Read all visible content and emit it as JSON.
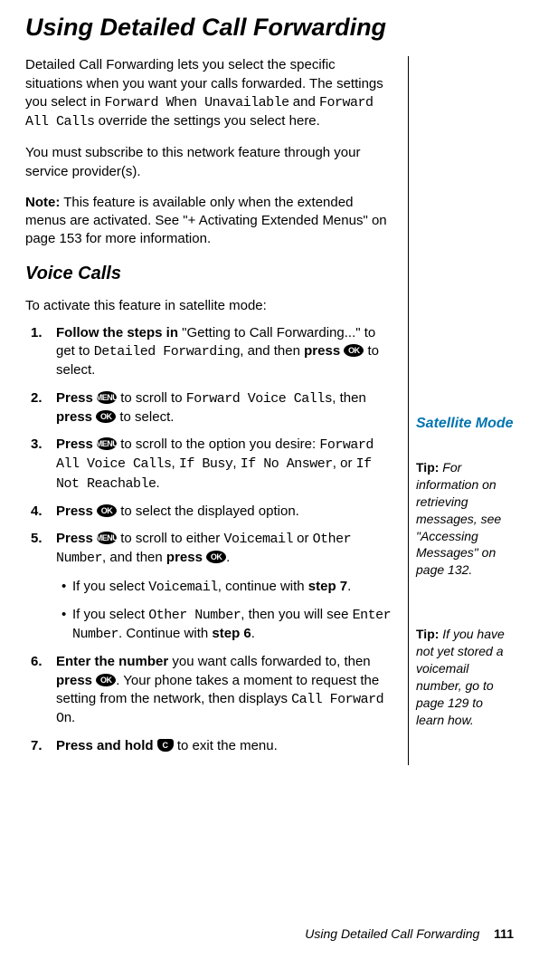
{
  "title": "Using Detailed Call Forwarding",
  "para1_a": "Detailed Call Forwarding lets you select the specific situations when you want your calls forwarded. The settings you select in ",
  "para1_m1": "Forward When Unavailable",
  "para1_b": " and ",
  "para1_m2": "Forward All Calls",
  "para1_c": " override the settings you select here.",
  "para2": "You must subscribe to this network feature through your service provider(s).",
  "note_label": "Note:",
  "note_body": " This feature is available only when the extended menus are activated. See \"+ Activating Extended Menus\" on page 153 for more information.",
  "subheading": "Voice Calls",
  "intro": "To activate this feature in satellite mode:",
  "step1_a": "Follow the steps in",
  "step1_b": " \"Getting to Call Forwarding...\" to get to ",
  "step1_m": "Detailed Forwarding",
  "step1_c": ", and then ",
  "step1_d": "press",
  "step1_e": " to select.",
  "step2_a": "Press",
  "step2_b": " to scroll to ",
  "step2_m": "Forward Voice Calls",
  "step2_c": ", then ",
  "step2_d": "press",
  "step2_e": " to select.",
  "step3_a": "Press",
  "step3_b": " to scroll to the option you desire: ",
  "step3_m1": "Forward All Voice Calls",
  "step3_m2": "If Busy",
  "step3_m3": "If No Answer",
  "step3_m4": "If Not Reachable",
  "step4_a": "Press",
  "step4_b": " to select the displayed option.",
  "step5_a": "Press",
  "step5_b": " to scroll to either ",
  "step5_m1": "Voicemail",
  "step5_c": " or ",
  "step5_m2": "Other Number",
  "step5_d": ", and then ",
  "step5_e": "press",
  "sub1_a": "If you select ",
  "sub1_m": "Voicemail",
  "sub1_b": ", continue with ",
  "sub1_c": "step 7",
  "sub2_a": "If you select ",
  "sub2_m1": "Other Number",
  "sub2_b": ", then you will see ",
  "sub2_m2": "Enter Number",
  "sub2_c": ". Continue with ",
  "sub2_d": "step 6",
  "step6_a": "Enter the number",
  "step6_b": " you want calls forwarded to, then ",
  "step6_c": "press",
  "step6_d": ". Your phone takes a moment to request the setting from the network, then displays ",
  "step6_m": "Call Forward On",
  "step7_a": "Press and hold",
  "step7_b": " to exit the menu.",
  "icon_ok": "OK",
  "icon_menu": "MENU",
  "icon_c": "C",
  "sat_mode": "Satellite Mode",
  "tip1_label": "Tip:",
  "tip1_body": " For information on retrieving messages, see \"Accessing Messages\" on page 132.",
  "tip2_label": "Tip:",
  "tip2_body": " If you have not yet stored a voicemail number, go to page 129 to learn how.",
  "footer_text": "Using Detailed Call Forwarding",
  "footer_page": "111"
}
